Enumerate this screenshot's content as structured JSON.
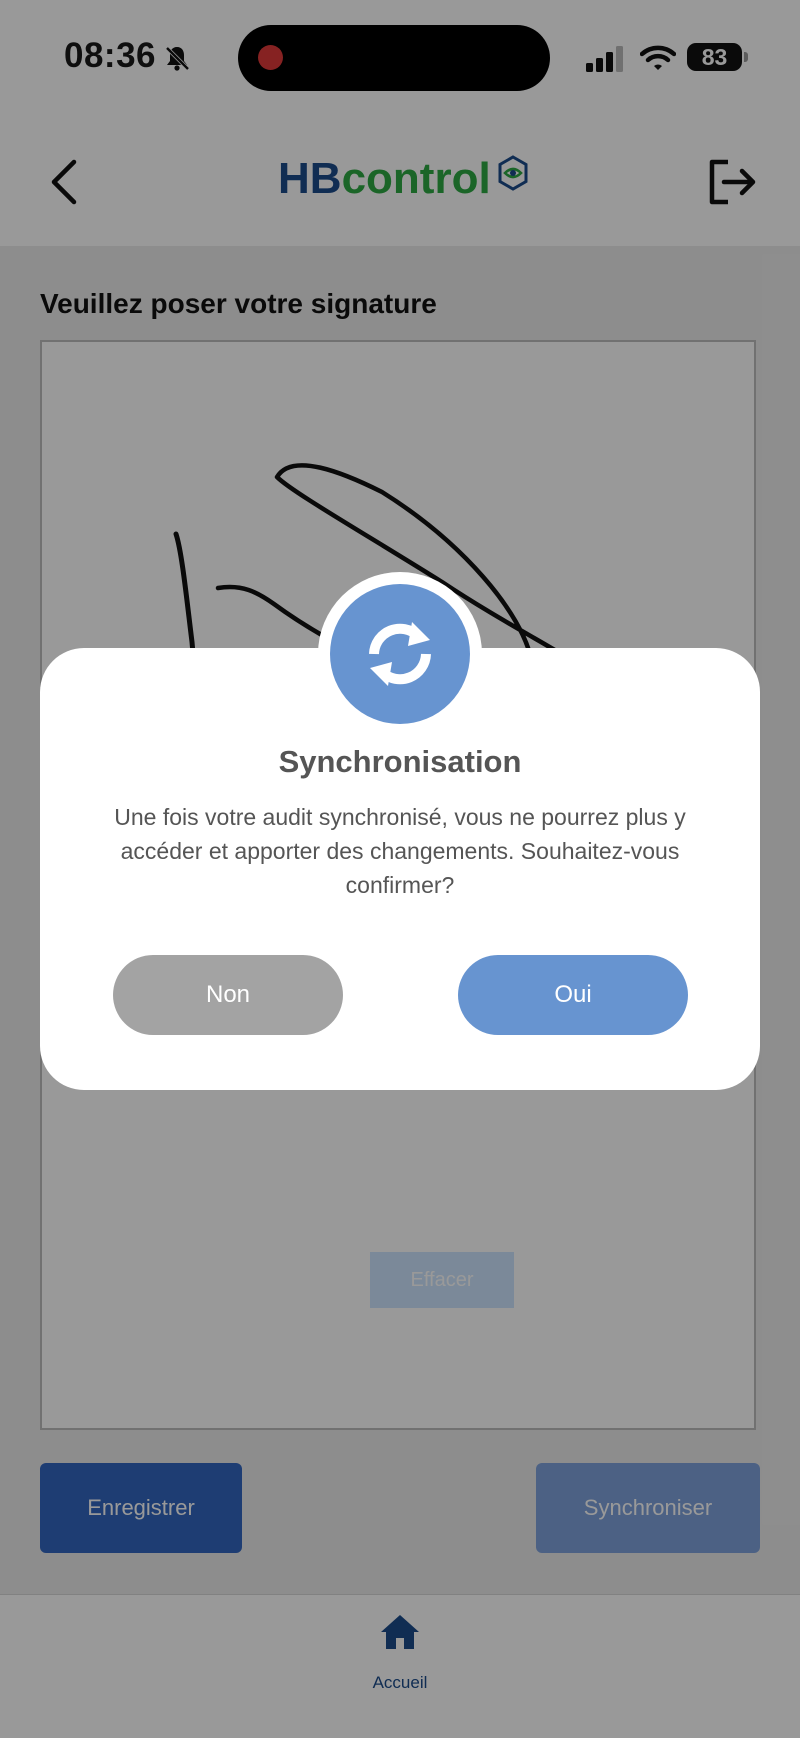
{
  "status_bar": {
    "time": "08:36",
    "battery_level": "83",
    "icons": [
      "bell-slash-icon",
      "recording-dot-icon",
      "signal-icon",
      "wifi-icon",
      "battery-icon"
    ]
  },
  "header": {
    "logo_part1": "HB",
    "logo_part2": "control",
    "logo_colors": {
      "hb": "#1b4b8a",
      "control": "#2ea843"
    },
    "icons": [
      "back-icon",
      "logo-eye-hexagon-icon",
      "logout-icon"
    ]
  },
  "page": {
    "title": "Veuillez poser votre signature",
    "clear_label": "Effacer",
    "save_label": "Enregistrer",
    "sync_label": "Synchroniser"
  },
  "bottom_nav": {
    "items": [
      {
        "label": "Accueil",
        "icon": "home-icon"
      }
    ]
  },
  "modal": {
    "icon": "sync-icon",
    "title": "Synchronisation",
    "message": "Une fois votre audit synchronisé, vous ne pourrez plus y accéder et apporter des changements. Souhaitez-vous confirmer?",
    "cancel_label": "Non",
    "confirm_label": "Oui"
  },
  "colors": {
    "primary": "#3366c0",
    "primary_light": "#7fa2dc",
    "modal_accent": "#6794d0",
    "cancel_grey": "#a3a3a3",
    "brand_blue": "#1b4b8a",
    "brand_green": "#2ea843"
  }
}
